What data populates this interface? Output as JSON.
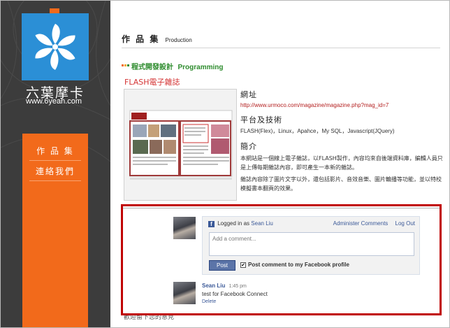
{
  "sidebar": {
    "brand_name": "六葉摩卡",
    "brand_url": "www.6yeah.com",
    "nav": [
      {
        "label": "作 品 集"
      },
      {
        "label": "連絡我們"
      }
    ]
  },
  "main": {
    "heading": "作 品 集",
    "heading_sub": "Production",
    "category_zh": "程式開發設計",
    "category_en": "Programming",
    "project_title": "FLASH電子雜誌",
    "info": {
      "url_title": "網址",
      "url": "http://www.urmoco.com/magazine/magazine.php?mag_id=7",
      "tech_title": "平台及技術",
      "tech": "FLASH(Flex)，Linux，Apahce，My SQL，Javascript(JQuery)",
      "intro_title": "簡介",
      "intro_1": "本網站是一個線上電子雜誌，以FLASH製作，內容均來自後端資料庫，編輯人員只是上傳每期雜誌內容，即可產生一本新的雜誌。",
      "intro_2": "雜誌內容除了圖片文字以外，還包括影片、音效音樂、圖片輪播等功能，並以特校模擬書本翻頁的效果。"
    }
  },
  "facebook": {
    "logged_in_prefix": "Logged in as",
    "user_name": "Sean Liu",
    "administer": "Administer Comments",
    "logout": "Log Out",
    "comment_placeholder": "Add a comment...",
    "post_label": "Post",
    "check_mark": "✔",
    "checkbox_label": "Post comment to my Facebook profile"
  },
  "comment": {
    "author": "Sean Liu",
    "time": "1:45 pm",
    "text": "test for Facebook Connect",
    "delete_label": "Delete"
  },
  "footer_cut_text": "歡迎留下您的意見",
  "colors": {
    "sidebar_bg": "#3c3c3c",
    "logo_blue": "#2b8fd6",
    "nav_orange": "#f26a1b",
    "category_green": "#2e8c2e",
    "title_red": "#d43434",
    "annotation_red": "#c00000",
    "facebook_blue": "#3b5998"
  }
}
